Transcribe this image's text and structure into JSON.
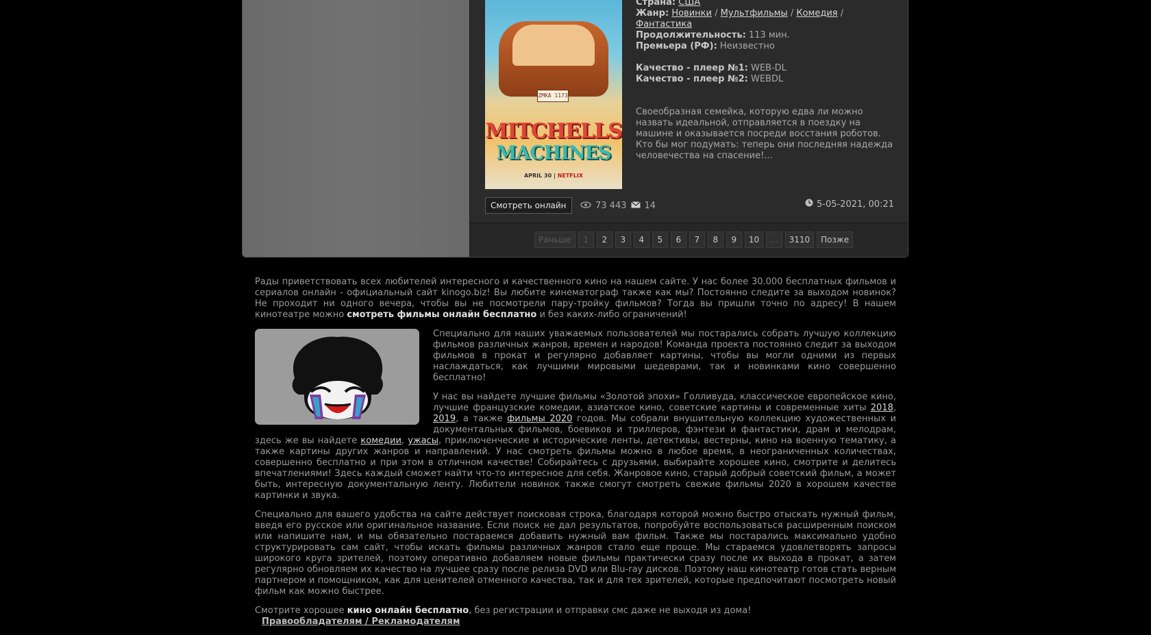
{
  "movie": {
    "country_label": "Страна:",
    "country": "США",
    "genre_label": "Жанр:",
    "genres": [
      "Новинки",
      "Мультфильмы",
      "Комедия",
      "Фантастика"
    ],
    "sep": "/",
    "duration_label": "Продолжительность:",
    "duration": "113 мин.",
    "premiere_label": "Премьера (РФ):",
    "premiere": "Неизвестно",
    "quality1_label": "Качество - плеер №1:",
    "quality1": "WEB-DL",
    "quality2_label": "Качество - плеер №2:",
    "quality2": "WEBDL",
    "description": "Своеобразная семейка, которую едва ли можно назвать идеальной, отправляется в поездку на машине и оказывается посреди восстания роботов. Кто бы мог подумать: теперь они последняя надежда человечества на спасение!...",
    "poster": {
      "title_line1": "MITCHELLS",
      "title_line2": "MACHINES",
      "plate": "ZMKA 1173",
      "date": "APRIL 30",
      "brand": "NETFLIX"
    },
    "watch_button": "Смотреть онлайн",
    "views": "73 443",
    "comments": "14",
    "date": "5-05-2021, 00:21"
  },
  "pagination": {
    "prev": "Раньше",
    "pages": [
      "1",
      "2",
      "3",
      "4",
      "5",
      "6",
      "7",
      "8",
      "9",
      "10"
    ],
    "ellipsis": "...",
    "last": "3110",
    "next": "Позже"
  },
  "about": {
    "p1_text": "Рады приветствовать всех любителей интересного и качественного кино на нашем сайте. У нас более 30.000 бесплатных фильмов и сериалов онлайн - официальный сайт kinogo.biz! Вы любите кинематограф также как мы? Постоянно следите за выходом новинок? Не проходит ни одного вечера, чтобы вы не посмотрели пару-тройку фильмов? Тогда вы пришли точно по адресу! В нашем кинотеатре можно ",
    "p1_bold": "смотреть фильмы онлайн бесплатно",
    "p1_end": " и без каких-либо ограничений!",
    "p2": "Специально для наших уважаемых пользователей мы постарались собрать лучшую коллекцию фильмов различных жанров, времен и народов! Команда проекта постоянно следит за выходом фильмов в прокат и регулярно добавляет картины, чтобы вы могли одними из первых наслаждаться, как лучшими мировыми шедеврами, так и новинками кино совершенно бесплатно!",
    "p3_a": "У нас вы найдете лучшие фильмы «Золотой эпохи» Голливуда, классическое европейское кино, лучшие французские комедии, азиатское кино, советские картины и современные хиты ",
    "link_2018": "2018",
    "p3_b": ", ",
    "link_2019": "2019",
    "p3_c": ", а также ",
    "link_films2020": "фильмы 2020",
    "p3_d": " годов. Мы собрали внушительную коллекцию художественных и документальных фильмов, боевиков и триллеров, фэнтези и фантастики, драм и мелодрам, здесь же вы найдете ",
    "link_comedy": "комедии",
    "p3_e": ", ",
    "link_horror": "ужасы",
    "p3_f": ", приключенческие и исторические ленты, детективы, вестерны, кино на военную тематику, а также картины других жанров и направлений. У нас смотреть фильмы можно в любое время, в неограниченных количествах, совершенно бесплатно и при этом в отличном качестве! Собирайтесь с друзьями, выбирайте хорошее кино, смотрите и делитесь впечатлениями! Здесь каждый сможет найти что-то интересное для себя. Жанровое кино, старый добрый советский фильм, а может быть, интересную документальную ленту. Любители новинок также смогут смотреть свежие фильмы 2020 в хорошем качестве картинки и звука.",
    "p4": "Специально для вашего удобства на сайте действует поисковая строка, благодаря которой можно быстро отыскать нужный фильм, введя его русское или оригинальное название. Если поиск не дал результатов, попробуйте воспользоваться расширенным поиском или напишите нам, и мы обязательно постараемся добавить нужный вам фильм. Также мы постарались максимально удобно структурировать сам сайт, чтобы искать фильмы различных жанров стало еще проще. Мы стараемся удовлетворять запросы широкого круга зрителей, поэтому оперативно добавляем новые фильмы практически сразу после их выхода в прокат, а затем регулярно обновляем их качество на лучшее сразу после релиза DVD или Blu-ray дисков. Поэтому наш кинотеатр готов стать верным партнером и помощником, как для ценителей отменного качества, так и для тех зрителей, которые предпочитают посмотреть новый фильм как можно быстрее.",
    "p5_a": "Смотрите хорошее ",
    "p5_bold": "кино онлайн бесплатно",
    "p5_b": ", без регистрации и отправки смс даже не выходя из дома!"
  },
  "footer": {
    "rights_link": "Правообладателям / Рекламодателям"
  },
  "icons": {
    "views": "eye-icon",
    "comments": "mail-icon",
    "date": "clock-icon"
  },
  "colors": {
    "background": "#000000",
    "panel": "#2b2b2b",
    "sidebar": "#6e6e6e",
    "link": "#d6d6d6"
  }
}
